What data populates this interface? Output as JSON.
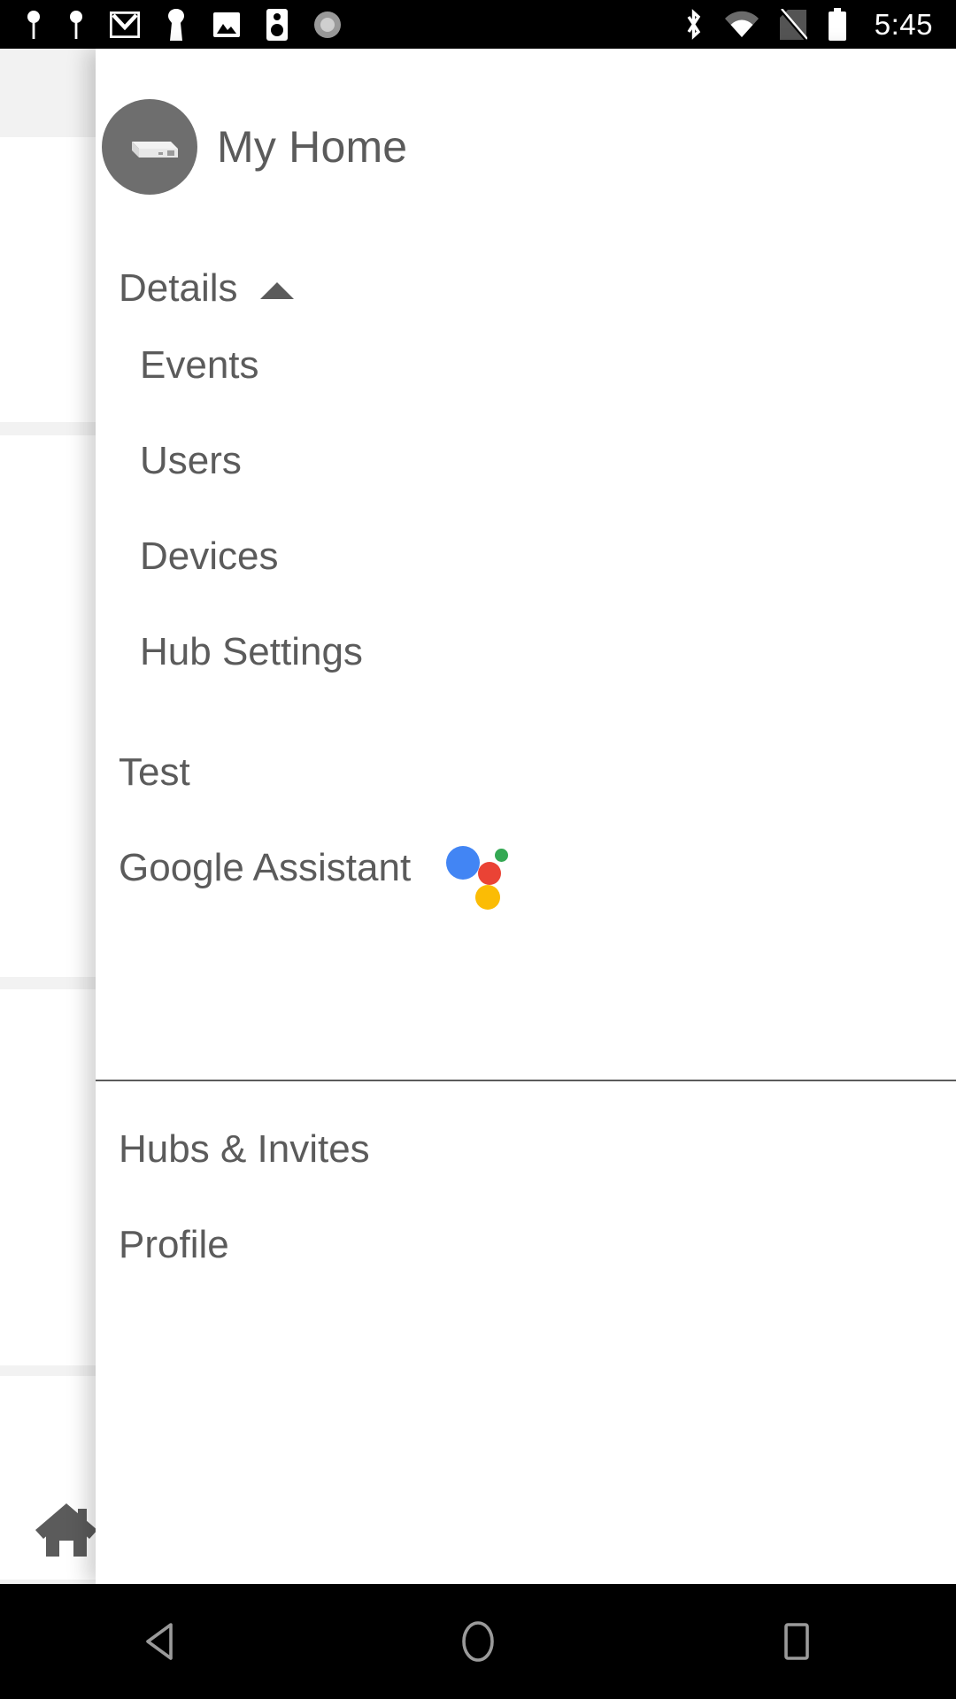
{
  "statusbar": {
    "time": "5:45",
    "left_icons": [
      {
        "name": "location-pin-icon"
      },
      {
        "name": "location-pin-icon"
      },
      {
        "name": "gmail-icon"
      },
      {
        "name": "keyhole-icon"
      },
      {
        "name": "photo-icon"
      },
      {
        "name": "speaker-icon"
      },
      {
        "name": "circular-sync-icon"
      }
    ],
    "right_icons": [
      {
        "name": "bluetooth-icon"
      },
      {
        "name": "wifi-icon"
      },
      {
        "name": "no-sim-icon"
      },
      {
        "name": "battery-icon"
      }
    ]
  },
  "drawer": {
    "header": {
      "title": "My Home",
      "avatar_icon": "hub-device-avatar"
    },
    "section": {
      "label": "Details",
      "caret_icon": "caret-up-icon",
      "expanded": true,
      "items": [
        {
          "label": "Events"
        },
        {
          "label": "Users"
        },
        {
          "label": "Devices"
        },
        {
          "label": "Hub Settings"
        }
      ]
    },
    "root_items": [
      {
        "label": "Test"
      },
      {
        "label": "Google Assistant",
        "icon": "google-assistant-logo"
      }
    ],
    "bottom_items": [
      {
        "label": "Hubs & Invites"
      },
      {
        "label": "Profile"
      }
    ]
  },
  "background_app": {
    "home_icon": "home-icon"
  },
  "navbar": {
    "back": "back-triangle-icon",
    "home": "home-circle-icon",
    "recents": "recents-square-icon"
  },
  "colors": {
    "text": "#5b5b5b",
    "statusbar_bg": "#000000",
    "drawer_bg": "#ffffff",
    "avatar_bg": "#6e6e6e",
    "assistant_blue": "#4285f4",
    "assistant_red": "#ea4335",
    "assistant_green": "#34a853",
    "assistant_yellow": "#fbbc05"
  }
}
